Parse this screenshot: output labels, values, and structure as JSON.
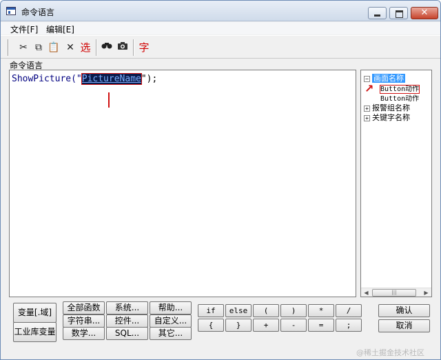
{
  "window": {
    "title": "命令语言"
  },
  "menu": [
    "文件[F]",
    "编辑[E]"
  ],
  "toolbar": {
    "select_label": "选",
    "char_label": "字",
    "icons": [
      "cut-icon",
      "copy-icon",
      "paste-icon",
      "delete-icon",
      "find-icon",
      "camera-icon"
    ]
  },
  "editor": {
    "section_label": "命令语言",
    "code_prefix": "ShowPicture(\"",
    "selected_text": "PictureName",
    "code_suffix": "\");"
  },
  "tree": {
    "root": "画面名称",
    "children": [
      "Button动作",
      "Button动作"
    ],
    "siblings": [
      "报警组名称",
      "关键字名称"
    ]
  },
  "buttons": {
    "left": [
      "变量[.域]",
      "工业库变量"
    ],
    "functions": [
      [
        "全部函数",
        "系统...",
        "帮助..."
      ],
      [
        "字符串...",
        "控件...",
        "自定义..."
      ],
      [
        "数学...",
        "SQL...",
        "其它..."
      ]
    ],
    "operators": [
      [
        "if",
        "else",
        "(",
        ")",
        "*",
        "/"
      ],
      [
        "{",
        "}",
        "+",
        "-",
        "=",
        ";"
      ]
    ],
    "ok": "确认",
    "cancel": "取消"
  },
  "watermark": "@稀土掘金技术社区"
}
